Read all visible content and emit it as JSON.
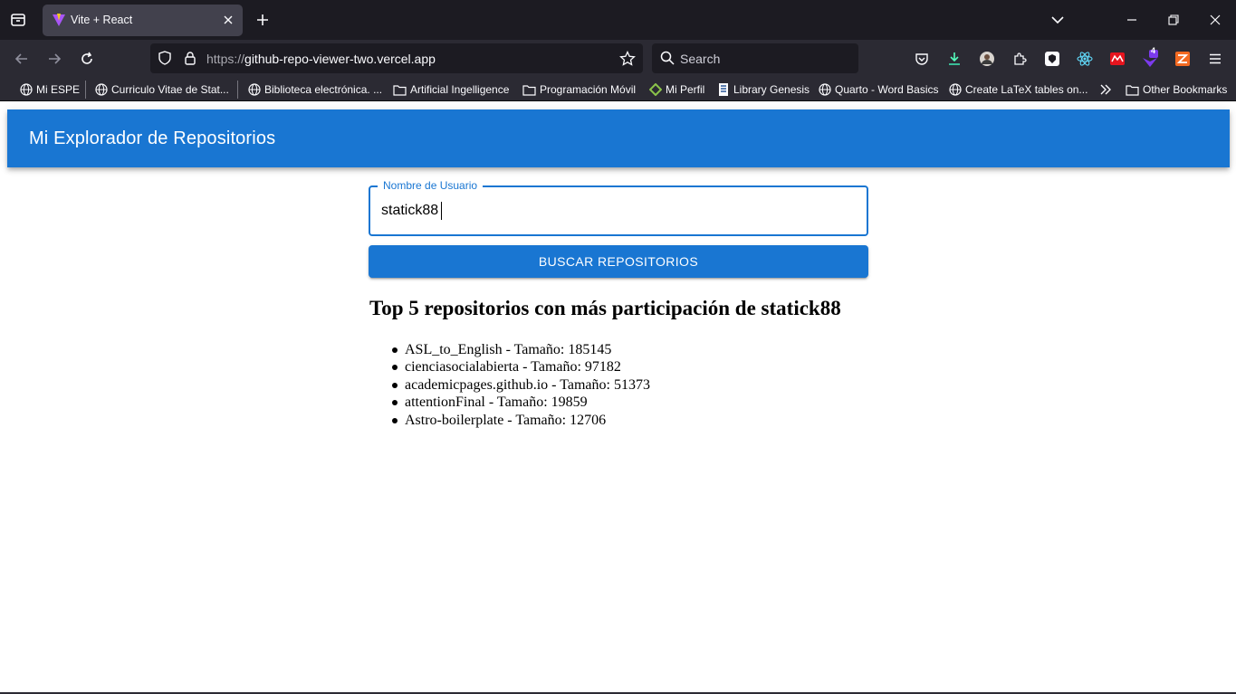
{
  "browser": {
    "tab_title": "Vite + React",
    "url_scheme": "https://",
    "url_host": "github-repo-viewer-two.vercel.app",
    "search_placeholder": "Search",
    "extension_badge": "4",
    "bookmarks": [
      {
        "label": "Mi ESPE",
        "icon": "globe-icon"
      },
      {
        "label": "Curriculo Vitae de Stat...",
        "icon": "globe-icon"
      },
      {
        "label": "Biblioteca electrónica. ...",
        "icon": "globe-icon"
      },
      {
        "label": "Artificial Ingelligence",
        "icon": "folder-icon"
      },
      {
        "label": "Programación Móvil",
        "icon": "folder-icon"
      },
      {
        "label": "Mi Perfil",
        "icon": "diamond-icon"
      },
      {
        "label": "Library Genesis",
        "icon": "book-icon"
      },
      {
        "label": "Quarto - Word Basics",
        "icon": "globe-icon"
      },
      {
        "label": "Create LaTeX tables on...",
        "icon": "globe-icon"
      }
    ],
    "other_bookmarks": "Other Bookmarks",
    "colors": {
      "chrome_dark": "#1c1b22",
      "chrome": "#2b2a33",
      "tab_active": "#42414d"
    }
  },
  "app": {
    "title": "Mi Explorador de Repositorios",
    "username_label": "Nombre de Usuario",
    "username_value": "statick88",
    "search_button": "BUSCAR REPOSITORIOS",
    "results_heading": "Top 5 repositorios con más participación de statick88",
    "repos": [
      "ASL_to_English - Tamaño: 185145",
      "cienciasocialabierta - Tamaño: 97182",
      "academicpages.github.io - Tamaño: 51373",
      "attentionFinal - Tamaño: 19859",
      "Astro-boilerplate - Tamaño: 12706"
    ],
    "colors": {
      "primary": "#1976d2",
      "background": "#ffffff"
    }
  }
}
